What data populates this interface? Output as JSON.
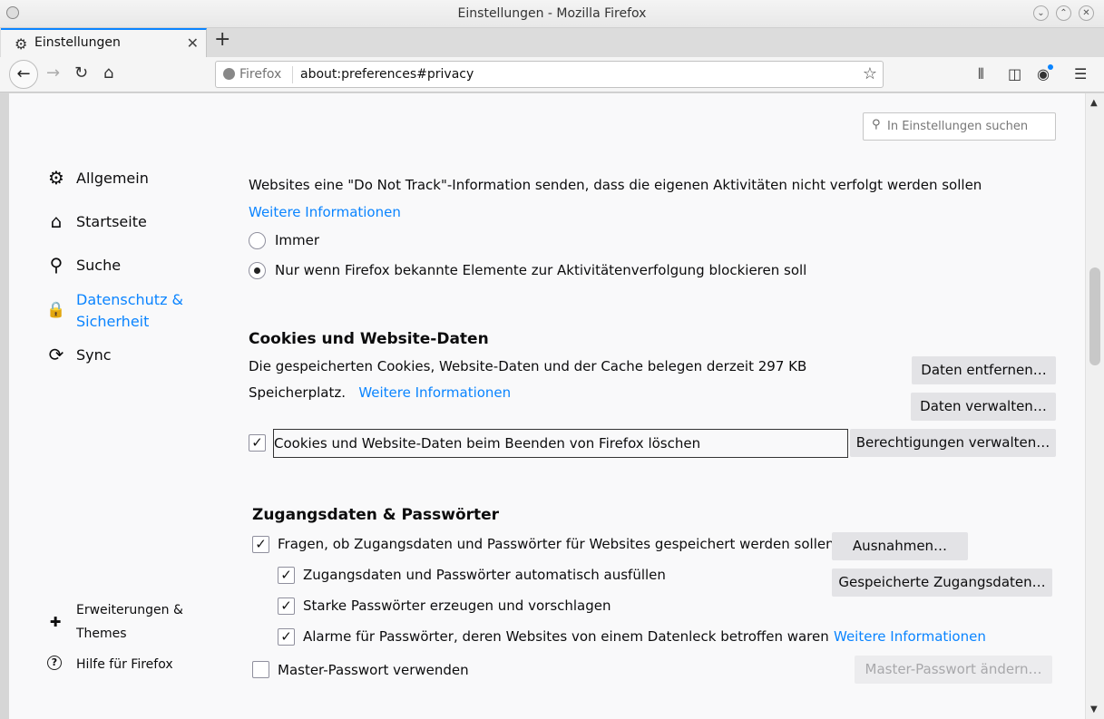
{
  "window": {
    "title": "Einstellungen - Mozilla Firefox",
    "minimize_glyph": "⌄",
    "maximize_glyph": "⌃",
    "close_glyph": "✕"
  },
  "tab": {
    "label": "Einstellungen",
    "icon": "gear-icon",
    "close_glyph": "✕",
    "new_tab_glyph": "+"
  },
  "nav": {
    "identity_label": "Firefox",
    "url": "about:preferences#privacy",
    "back_glyph": "←",
    "forward_glyph": "→",
    "reload_glyph": "↻",
    "home_glyph": "⌂",
    "star_glyph": "☆",
    "library_glyph": "⫴",
    "sidebar_glyph": "◫",
    "account_glyph": "◉",
    "menu_glyph": "☰"
  },
  "search": {
    "placeholder": "In Einstellungen suchen",
    "icon_glyph": "⚲"
  },
  "sidebar": {
    "categories": [
      {
        "label": "Allgemein",
        "icon": "gear-icon",
        "glyph": "⚙"
      },
      {
        "label": "Startseite",
        "icon": "home-icon",
        "glyph": "⌂"
      },
      {
        "label": "Suche",
        "icon": "search-icon",
        "glyph": "⚲"
      },
      {
        "label_line1": "Datenschutz &",
        "label_line2": "Sicherheit",
        "icon": "lock-icon",
        "glyph": "🔒",
        "selected": true
      },
      {
        "label": "Sync",
        "icon": "sync-icon",
        "glyph": "⟳"
      }
    ],
    "footer": [
      {
        "label_line1": "Erweiterungen &",
        "label_line2": "Themes",
        "icon": "puzzle-icon",
        "glyph": "✚"
      },
      {
        "label": "Hilfe für Firefox",
        "icon": "help-icon",
        "glyph": "?"
      }
    ]
  },
  "dnt": {
    "description": "Websites eine \"Do Not Track\"-Information senden, dass die eigenen Aktivitäten nicht verfolgt werden sollen",
    "learn_more": "Weitere Informationen",
    "option_always": "Immer",
    "option_only_when_blocking": "Nur wenn Firefox bekannte Elemente zur Aktivitätenverfolgung blockieren soll",
    "selected": "option_only_when_blocking"
  },
  "cookies": {
    "heading": "Cookies und Website-Daten",
    "usage_line1": "Die gespeicherten Cookies, Website-Daten und der Cache belegen derzeit 297 KB",
    "usage_line2": "Speicherplatz.",
    "learn_more": "Weitere Informationen",
    "clear_button": "Daten entfernen…",
    "manage_button": "Daten verwalten…",
    "delete_on_close_label": "Cookies und Website-Daten beim Beenden von Firefox löschen",
    "delete_on_close_checked": true,
    "permissions_button": "Berechtigungen verwalten…"
  },
  "logins": {
    "heading": "Zugangsdaten & Passwörter",
    "ask_to_save_label": "Fragen, ob Zugangsdaten und Passwörter für Websites gespeichert werden sollen",
    "exceptions_button": "Ausnahmen…",
    "autofill_label": "Zugangsdaten und Passwörter automatisch ausfüllen",
    "saved_logins_button": "Gespeicherte Zugangsdaten…",
    "generate_label": "Starke Passwörter erzeugen und vorschlagen",
    "breach_alerts_label": "Alarme für Passwörter, deren Websites von einem Datenleck betroffen waren",
    "breach_learn_more": "Weitere Informationen",
    "master_password_label": "Master-Passwort verwenden",
    "master_password_button": "Master-Passwort ändern…",
    "check_glyph": "✓"
  }
}
